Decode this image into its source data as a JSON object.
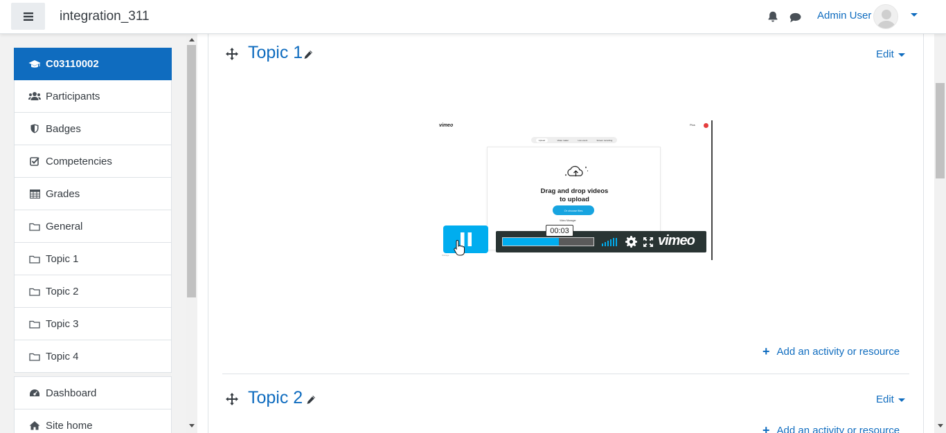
{
  "navbar": {
    "site_name": "integration_311",
    "user_name": "Admin User"
  },
  "sidebar": {
    "items": [
      {
        "label": "C03110002",
        "icon": "graduation-cap-icon",
        "active": true
      },
      {
        "label": "Participants",
        "icon": "users-icon"
      },
      {
        "label": "Badges",
        "icon": "shield-icon"
      },
      {
        "label": "Competencies",
        "icon": "check-square-icon"
      },
      {
        "label": "Grades",
        "icon": "table-icon"
      },
      {
        "label": "General",
        "icon": "folder-icon"
      },
      {
        "label": "Topic 1",
        "icon": "folder-icon"
      },
      {
        "label": "Topic 2",
        "icon": "folder-icon"
      },
      {
        "label": "Topic 3",
        "icon": "folder-icon"
      },
      {
        "label": "Topic 4",
        "icon": "folder-icon"
      }
    ],
    "items2": [
      {
        "label": "Dashboard",
        "icon": "dashboard-icon"
      },
      {
        "label": "Site home",
        "icon": "home-icon"
      }
    ]
  },
  "sections": [
    {
      "title": "Topic 1",
      "edit_label": "Edit",
      "add_label": "Add an activity or resource"
    },
    {
      "title": "Topic 2",
      "edit_label": "Edit",
      "add_label": "Add an activity or resource"
    }
  ],
  "video": {
    "logo": "vimeo",
    "tabs": [
      "Upload",
      "Video maker",
      "Live event",
      "Screen recording"
    ],
    "badge": "Plus",
    "heading_line1": "Drag and drop videos",
    "heading_line2": "to upload",
    "choose_label": "Or choose files",
    "manager_label": "Video Manager",
    "footer_left": "Storage",
    "time": "00:03",
    "brand": "vimeo",
    "progress": 0.62,
    "accent": "#00adef"
  },
  "colors": {
    "primary": "#0f6cbf",
    "drawer_bg": "#f2f2f2"
  }
}
